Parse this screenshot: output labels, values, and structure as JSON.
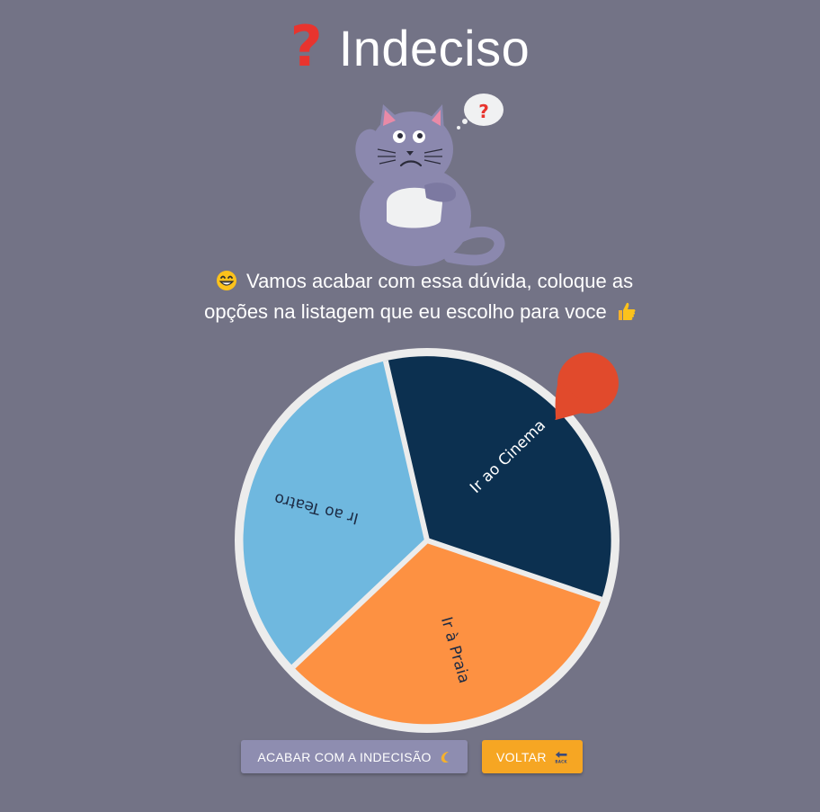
{
  "header": {
    "title": "Indeciso",
    "title_icon": "question-mark-icon"
  },
  "mascot": {
    "icon": "thinking-cat-illustration",
    "thought_bubble_symbol": "?"
  },
  "description": {
    "line1": "Vamos acabar com essa dúvida, coloque as",
    "line2": "opções na listagem que eu escolho para voce",
    "leading_emoji": "grinning-face-icon",
    "trailing_emoji": "thumbs-up-icon"
  },
  "wheel": {
    "segments": [
      {
        "label": "Ir ao Cinema",
        "color": "#0c3050",
        "text_color": "#ffffff"
      },
      {
        "label": "Ir à Praia",
        "color": "#fd9142",
        "text_color": "#1d2b44"
      },
      {
        "label": "Ir ao Teatro",
        "color": "#6fb8df",
        "text_color": "#1d2b44"
      }
    ],
    "rim_color": "#ececec",
    "pointer_color": "#e14a2c"
  },
  "actions": {
    "decide_label": "ACABAR COM A INDECISÃO",
    "decide_icon": "crescent-moon-icon",
    "back_label": "VOLTAR",
    "back_icon": "back-arrow-icon",
    "back_icon_text": "BACK"
  },
  "colors": {
    "background": "#737386",
    "primary_button": "#8e8db0",
    "back_button": "#f6a623",
    "title_icon": "#e8342e"
  }
}
